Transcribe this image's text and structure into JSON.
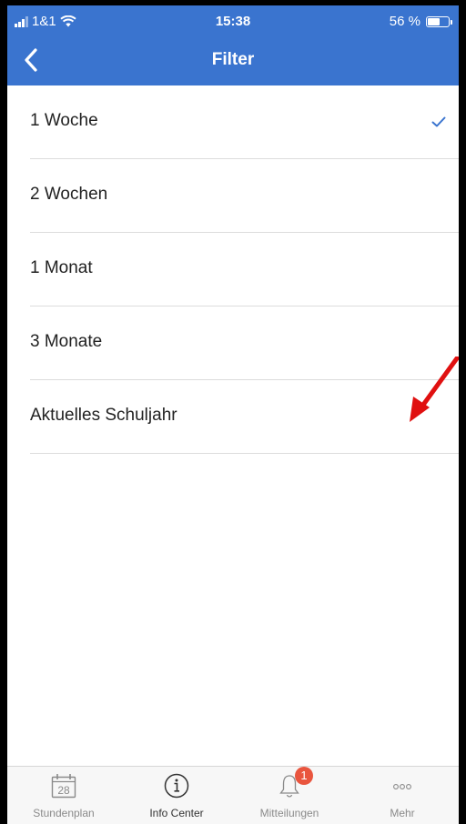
{
  "status_bar": {
    "carrier": "1&1",
    "time": "15:38",
    "battery_label": "56 %",
    "battery_level": 0.56
  },
  "navbar": {
    "title": "Filter",
    "back_icon": "chevron-left-icon"
  },
  "filter_options": [
    {
      "label": "1 Woche",
      "selected": true
    },
    {
      "label": "2 Wochen",
      "selected": false
    },
    {
      "label": "1 Monat",
      "selected": false
    },
    {
      "label": "3 Monate",
      "selected": false
    },
    {
      "label": "Aktuelles Schuljahr",
      "selected": false
    }
  ],
  "tabbar": {
    "tabs": [
      {
        "label": "Stundenplan",
        "icon": "calendar-icon",
        "icon_text": "28"
      },
      {
        "label": "Info Center",
        "icon": "info-icon",
        "active": true
      },
      {
        "label": "Mitteilungen",
        "icon": "bell-icon",
        "badge": "1"
      },
      {
        "label": "Mehr",
        "icon": "more-icon"
      }
    ]
  },
  "colors": {
    "header_blue": "#3a74cf",
    "check_blue": "#3a74cf",
    "badge_red": "#e9553e",
    "annotation_arrow": "#e01010"
  }
}
